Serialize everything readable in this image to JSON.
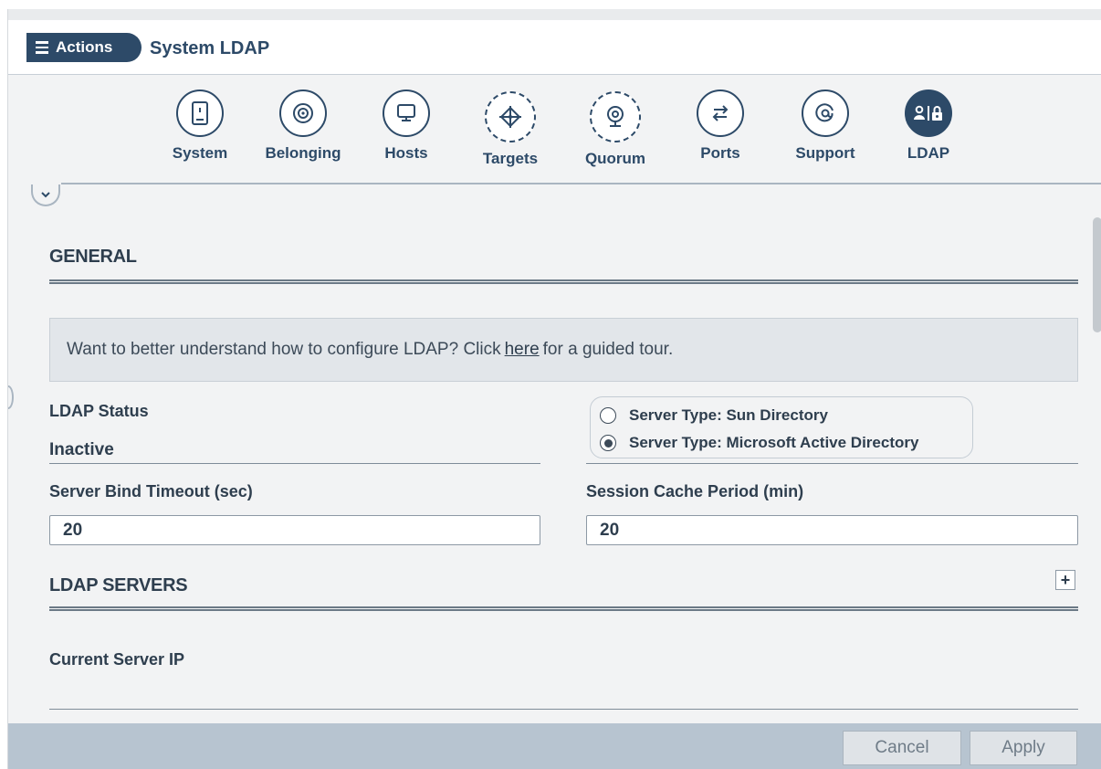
{
  "header": {
    "actions_label": "Actions",
    "title": "System LDAP"
  },
  "tabs": [
    {
      "label": "System",
      "icon": "device-icon",
      "active": false
    },
    {
      "label": "Belonging",
      "icon": "target-ring-icon",
      "active": false
    },
    {
      "label": "Hosts",
      "icon": "monitor-icon",
      "active": false
    },
    {
      "label": "Targets",
      "icon": "crosshair-icon",
      "active": false
    },
    {
      "label": "Quorum",
      "icon": "webcam-icon",
      "active": false
    },
    {
      "label": "Ports",
      "icon": "swap-arrows-icon",
      "active": false
    },
    {
      "label": "Support",
      "icon": "at-sign-icon",
      "active": false
    },
    {
      "label": "LDAP",
      "icon": "user-lock-icon",
      "active": true
    }
  ],
  "general": {
    "title": "GENERAL",
    "info_prefix": "Want to better understand how to configure LDAP? Click",
    "info_link": "here",
    "info_suffix": "for a guided tour.",
    "ldap_status_label": "LDAP Status",
    "ldap_status_value": "Inactive",
    "server_type_options": [
      {
        "label": "Server Type: Sun Directory",
        "selected": false
      },
      {
        "label": "Server Type: Microsoft Active Directory",
        "selected": true
      }
    ],
    "bind_timeout_label": "Server Bind Timeout (sec)",
    "bind_timeout_value": "20",
    "session_cache_label": "Session Cache Period (min)",
    "session_cache_value": "20"
  },
  "ldap_servers": {
    "title": "LDAP SERVERS",
    "add_label": "+",
    "current_ip_label": "Current Server IP"
  },
  "footer": {
    "cancel_label": "Cancel",
    "apply_label": "Apply"
  },
  "colors": {
    "brand": "#2d4a68",
    "background": "#f2f3f4",
    "footer": "#b7c4d0",
    "info_box": "#e2e6ea"
  }
}
